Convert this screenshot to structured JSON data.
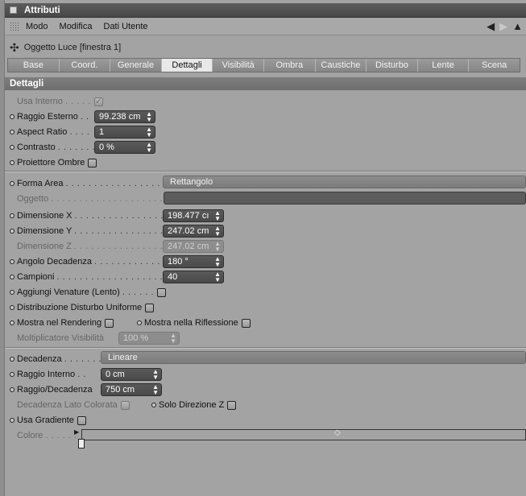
{
  "window": {
    "title": "Attributi"
  },
  "menu": [
    "Modo",
    "Modifica",
    "Dati Utente"
  ],
  "object": {
    "title": "Oggetto Luce [finestra 1]"
  },
  "tabs": [
    "Base",
    "Coord.",
    "Generale",
    "Dettagli",
    "Visibilità",
    "Ombra",
    "Caustiche",
    "Disturbo",
    "Lente",
    "Scena"
  ],
  "active_tab": "Dettagli",
  "section": {
    "title": "Dettagli"
  },
  "fields": {
    "usa_interno": {
      "label": "Usa Interno",
      "dots": ". . . . .",
      "checked": true
    },
    "raggio_esterno": {
      "label": "Raggio Esterno",
      "dots": ". .",
      "value": "99.238 cm"
    },
    "aspect_ratio": {
      "label": "Aspect Ratio",
      "dots": ". . . .",
      "value": "1"
    },
    "contrasto": {
      "label": "Contrasto",
      "dots": ". . . . . . .",
      "value": "0 %"
    },
    "proiettore_ombre": {
      "label": "Proiettore Ombre"
    },
    "forma_area": {
      "label": "Forma Area",
      "dots": ". . . . . . . . . . . . . . . . . . . . .",
      "value": "Rettangolo"
    },
    "oggetto": {
      "label": "Oggetto",
      "dots": ". . . . . . . . . . . . . . . . . . . . . . . ."
    },
    "dimensione_x": {
      "label": "Dimensione X",
      "dots": ". . . . . . . . . . . . . . . . .",
      "value": "198.477 cı"
    },
    "dimensione_y": {
      "label": "Dimensione Y",
      "dots": ". . . . . . . . . . . . . . . . .",
      "value": "247.02 cm"
    },
    "dimensione_z": {
      "label": "Dimensione Z",
      "dots": ". . . . . . . . . . . . . . . . .",
      "value": "247.02 cm"
    },
    "angolo_decadenza": {
      "label": "Angolo Decadenza",
      "dots": ". . . . . . . . . . . . .",
      "value": "180 °"
    },
    "campioni": {
      "label": "Campioni",
      "dots": ". . . . . . . . . . . . . . . . . . . . .",
      "value": "40"
    },
    "aggiungi_venature": {
      "label": "Aggiungi Venature (Lento)",
      "dots": ". . . . . ."
    },
    "distribuzione_disturbo": {
      "label": "Distribuzione Disturbo Uniforme"
    },
    "mostra_rendering": {
      "label": "Mostra nel Rendering"
    },
    "mostra_riflessione": {
      "label": "Mostra nella Riflessione"
    },
    "moltiplicatore_visibilita": {
      "label": "Moltiplicatore Visibilità",
      "value": "100 %"
    },
    "decadenza": {
      "label": "Decadenza",
      "dots": ". . . . . . . .",
      "value": "Lineare"
    },
    "raggio_interno": {
      "label": "Raggio Interno",
      "dots": ". .",
      "value": "0 cm"
    },
    "raggio_decadenza": {
      "label": "Raggio/Decadenza",
      "value": "750 cm"
    },
    "decadenza_lato_colorata": {
      "label": "Decadenza Lato Colorata"
    },
    "solo_direzione_z": {
      "label": "Solo Direzione Z"
    },
    "usa_gradiente": {
      "label": "Usa Gradiente"
    },
    "colore": {
      "label": "Colore",
      "dots": ". . . . . ."
    }
  },
  "icons": {
    "lamp": "light-object-icon",
    "back": "arrow-left-icon",
    "forward": "arrow-right-icon",
    "up": "arrow-up-icon"
  },
  "colors": {
    "titlebar": "#4f4f4f",
    "panel": "#a3a3a3",
    "field": "#4f4f4f",
    "active_tab": "#e8e8e8"
  }
}
